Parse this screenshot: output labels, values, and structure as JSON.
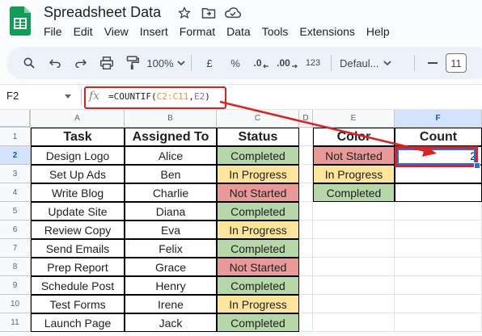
{
  "app": {
    "title": "Spreadsheet Data",
    "menu": [
      "File",
      "Edit",
      "View",
      "Insert",
      "Format",
      "Data",
      "Tools",
      "Extensions",
      "Help"
    ]
  },
  "toolbar": {
    "zoom": "100%",
    "currency": "£",
    "percent": "%",
    "dec_decrease": ".0",
    "dec_increase": ".00",
    "more_formats": "123",
    "font": "Defaul...",
    "font_size": "11"
  },
  "formula_bar": {
    "cell_ref": "F2",
    "fx": "fx",
    "prefix": "=COUNTIF(",
    "range1": "C2:C11",
    "comma": ",",
    "range2": "E2",
    "suffix": ")"
  },
  "columns": [
    "A",
    "B",
    "C",
    "D",
    "E",
    "F"
  ],
  "rows": [
    "1",
    "2",
    "3",
    "4",
    "5",
    "6",
    "7",
    "8",
    "9",
    "10",
    "11"
  ],
  "table": {
    "headers": [
      "Task",
      "Assigned To",
      "Status"
    ],
    "rows": [
      [
        "Design Logo",
        "Alice",
        "Completed"
      ],
      [
        "Set Up Ads",
        "Ben",
        "In Progress"
      ],
      [
        "Write Blog",
        "Charlie",
        "Not Started"
      ],
      [
        "Update Site",
        "Diana",
        "Completed"
      ],
      [
        "Review Copy",
        "Eva",
        "In Progress"
      ],
      [
        "Send Emails",
        "Felix",
        "Completed"
      ],
      [
        "Prep Report",
        "Grace",
        "Not Started"
      ],
      [
        "Schedule Post",
        "Henry",
        "Completed"
      ],
      [
        "Test Forms",
        "Irene",
        "In Progress"
      ],
      [
        "Launch Page",
        "Jack",
        "Completed"
      ]
    ]
  },
  "summary": {
    "headers": [
      "Color",
      "Count"
    ],
    "rows": [
      [
        "Not Started",
        "2"
      ],
      [
        "In Progress",
        ""
      ],
      [
        "Completed",
        ""
      ]
    ]
  },
  "status_colors": {
    "Completed": "#b6d7a8",
    "In Progress": "#ffe599",
    "Not Started": "#ea9999"
  },
  "colors": {
    "annotation": "#e02020",
    "selection": "#1a73e8"
  }
}
